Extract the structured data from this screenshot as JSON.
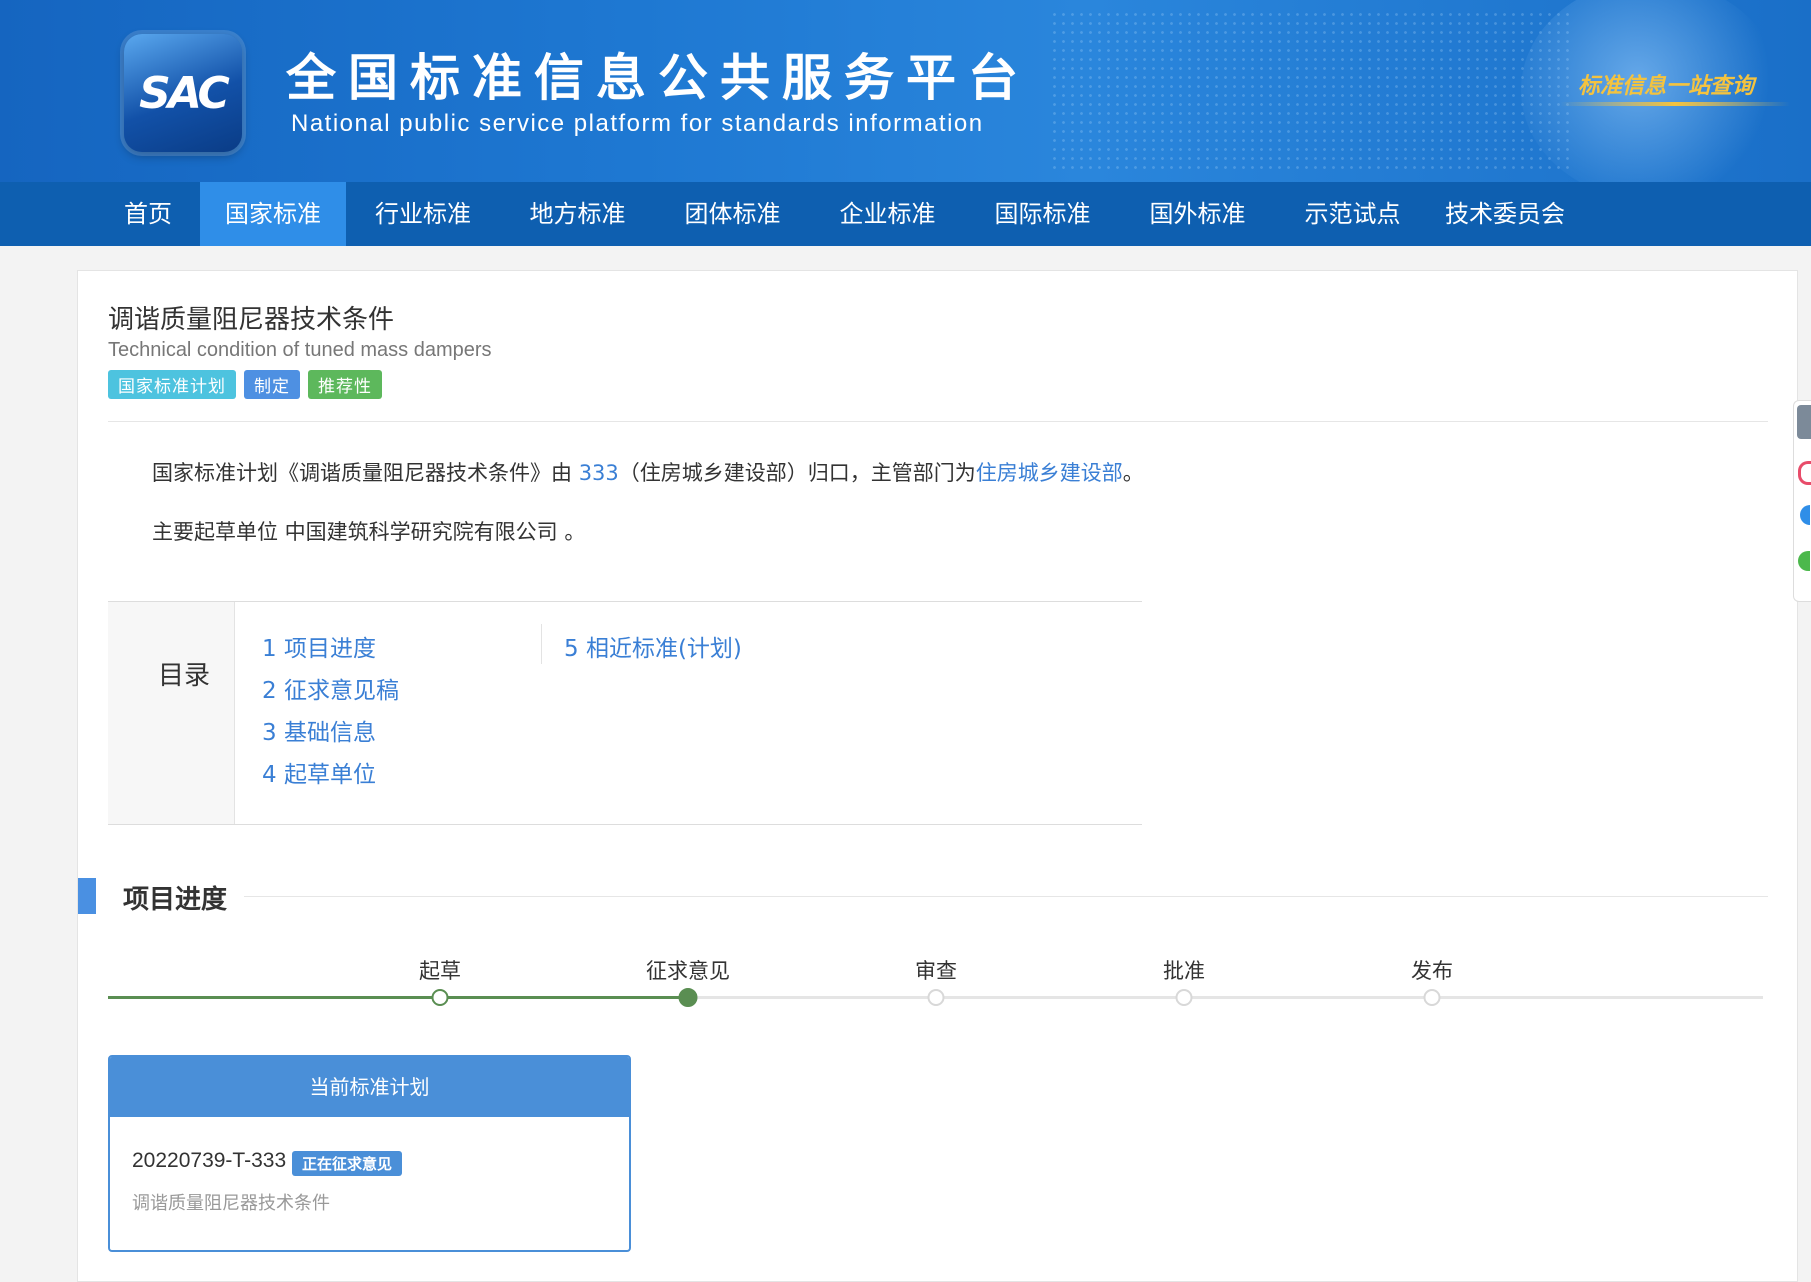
{
  "header": {
    "logo_text": "SAC",
    "site_title": "全国标准信息公共服务平台",
    "site_subtitle": "National public service platform  for standards information",
    "slogan": "标准信息一站查询"
  },
  "nav": {
    "items": [
      "首页",
      "国家标准",
      "行业标准",
      "地方标准",
      "团体标准",
      "企业标准",
      "国际标准",
      "国外标准",
      "示范试点",
      "技术委员会"
    ],
    "active_index": 1
  },
  "standard": {
    "title_cn": "调谐质量阻尼器技术条件",
    "title_en": "Technical condition of tuned mass dampers",
    "tags": [
      "国家标准计划",
      "制定",
      "推荐性"
    ]
  },
  "description": {
    "line1_prefix": "国家标准计划《调谐质量阻尼器技术条件》由 ",
    "line1_link1": "333",
    "line1_middle": "（住房城乡建设部）归口，主管部门为",
    "line1_link2": "住房城乡建设部",
    "line1_suffix": "。",
    "line2": "主要起草单位 中国建筑科学研究院有限公司 。"
  },
  "toc": {
    "label": "目录",
    "items": [
      "1  项目进度",
      "2  征求意见稿",
      "3  基础信息",
      "4  起草单位",
      "5  相近标准(计划)"
    ]
  },
  "progress": {
    "section_title": "项目进度",
    "steps": [
      "起草",
      "征求意见",
      "审查",
      "批准",
      "发布"
    ],
    "current_step": "征求意见",
    "completed_steps": 2
  },
  "plan": {
    "header": "当前标准计划",
    "code": "20220739-T-333",
    "status": "正在征求意见",
    "name": "调谐质量阻尼器技术条件"
  },
  "colors": {
    "nav_bg": "#0e5fb0",
    "nav_active": "#2f8ee8",
    "link": "#3a7fd5",
    "progress_done": "#5a8e52",
    "accent": "#4a8fd8"
  }
}
